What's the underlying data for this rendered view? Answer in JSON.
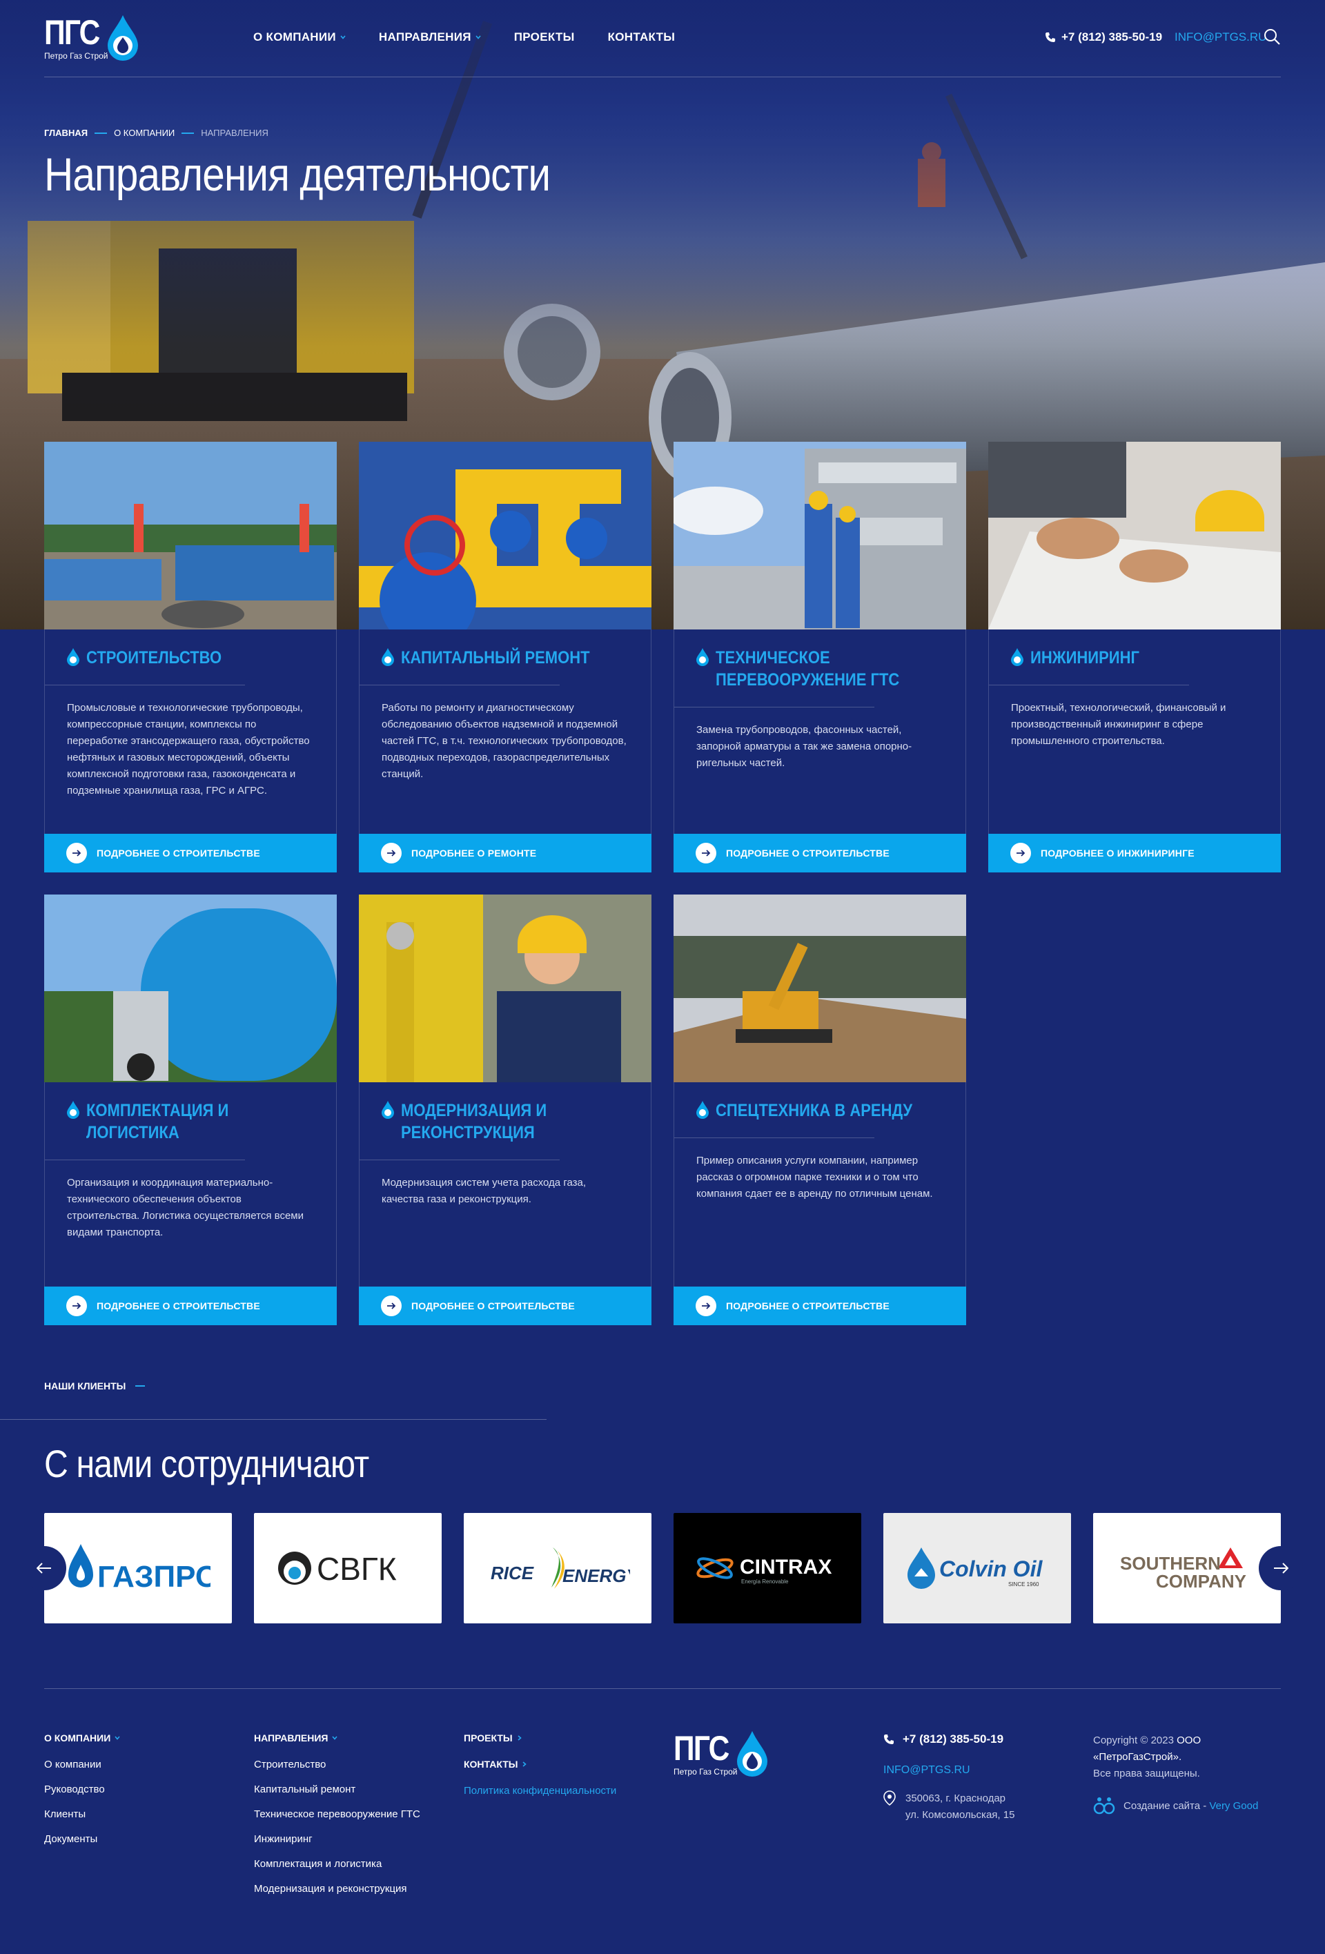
{
  "colors": {
    "background": "#182873",
    "accent": "#24a9ef",
    "button": "#0aa6ec"
  },
  "header": {
    "logo_text": "ПГС",
    "logo_sub": "Петро Газ Строй",
    "nav": [
      {
        "label": "О компании",
        "has_dropdown": true
      },
      {
        "label": "Направления",
        "has_dropdown": true
      },
      {
        "label": "Проекты",
        "has_dropdown": false
      },
      {
        "label": "Контакты",
        "has_dropdown": false
      }
    ],
    "phone": "+7 (812) 385-50-19",
    "email": "INFO@PTGS.RU",
    "search_icon": "search-icon"
  },
  "breadcrumb": [
    "Главная",
    "О компании",
    "Направления"
  ],
  "page_title": "Направления деятельности",
  "cards": [
    {
      "title": "Строительство",
      "text": "Промысловые и технологические трубопроводы, компрессорные станции, комплексы по переработке этансодержащего газа, обустройство нефтяных и газовых месторождений, объекты комплексной подготовки газа, газоконденсата и подземные хранилища газа, ГРС и АГРС.",
      "button": "Подробнее о строительстве"
    },
    {
      "title": "Капитальный ремонт",
      "text": "Работы по ремонту и диагностическому обследованию объектов надземной и подземной частей ГТС, в т.ч. технологических трубопроводов, подводных переходов, газораспределительных станций.",
      "button": "Подробнее о ремонте"
    },
    {
      "title": "Техническое перевооружение ГТС",
      "text": "Замена трубопроводов, фасонных частей, запорной арматуры а так же замена опорно-ригельных частей.",
      "button": "Подробнее о строительстве"
    },
    {
      "title": "Инжиниринг",
      "text": "Проектный, технологический, финансовый и производственный инжиниринг в сфере промышленного строительства.",
      "button": "Подробнее о инжиниринге"
    },
    {
      "title": "Комплектация и логистика",
      "text": "Организация и координация материально-технического обеспечения объектов строительства. Логистика осуществляется всеми видами транспорта.",
      "button": "Подробнее о строительстве"
    },
    {
      "title": "Модернизация и реконструкция",
      "text": "Модернизация систем учета расхода газа, качества газа и реконструкция.",
      "button": "Подробнее о строительстве"
    },
    {
      "title": "Спецтехника в аренду",
      "text": "Пример описания услуги компании, например рассказ о огромном парке техники и о том что компания сдает ее в аренду по отличным ценам.",
      "button": "Подробнее о строительстве"
    }
  ],
  "clients": {
    "eyebrow": "Наши клиенты",
    "title": "С нами сотрудничают",
    "logos": [
      {
        "name": "ГАЗПРОМ"
      },
      {
        "name": "СВГК"
      },
      {
        "name": "RICE",
        "name2": "ENERGY"
      },
      {
        "name": "CINTRAX",
        "sub": "Energía Renovable"
      },
      {
        "name": "Colvin Oil",
        "sub": "SINCE 1960"
      },
      {
        "name": "SOUTHERN",
        "name2": "COMPANY"
      }
    ]
  },
  "footer": {
    "col1": {
      "head": "О компании",
      "links": [
        "О компании",
        "Руководство",
        "Клиенты",
        "Документы"
      ]
    },
    "col2": {
      "head": "Направления",
      "links": [
        "Строительство",
        "Капитальный ремонт",
        "Техническое перевооружение ГТС",
        "Инжиниринг",
        "Комплектация и логистика",
        "Модернизация и реконструкция"
      ]
    },
    "col3": {
      "projects": "Проекты",
      "contacts": "Контакты",
      "policy": "Политика конфиденциальности"
    },
    "phone": "+7 (812) 385-50-19",
    "email": "INFO@PTGS.RU",
    "address_line1": "350063, г. Краснодар",
    "address_line2": "ул. Комсомольская, 15",
    "copyright_prefix": "Copyright © 2023",
    "copyright_company": "ООО «ПетроГазСтрой».",
    "rights": "Все права защищены.",
    "madeby_prefix": "Создание сайта -",
    "madeby_link": "Very Good"
  }
}
